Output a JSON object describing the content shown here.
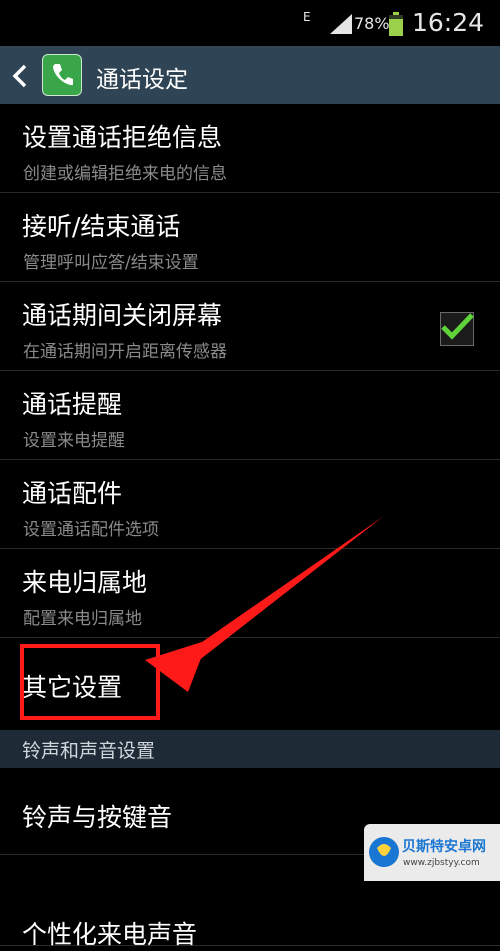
{
  "status": {
    "network": "E",
    "battery_pct": "78%",
    "time": "16:24"
  },
  "header": {
    "title": "通话设定"
  },
  "items": [
    {
      "title": "设置通话拒绝信息",
      "subtitle": "创建或编辑拒绝来电的信息"
    },
    {
      "title": "接听/结束通话",
      "subtitle": "管理呼叫应答/结束设置"
    },
    {
      "title": "通话期间关闭屏幕",
      "subtitle": "在通话期间开启距离传感器",
      "checked": true
    },
    {
      "title": "通话提醒",
      "subtitle": "设置来电提醒"
    },
    {
      "title": "通话配件",
      "subtitle": "设置通话配件选项"
    },
    {
      "title": "来电归属地",
      "subtitle": "配置来电归属地"
    },
    {
      "title": "其它设置"
    }
  ],
  "section": {
    "title": "铃声和声音设置"
  },
  "sound_items": [
    {
      "title": "铃声与按键音"
    },
    {
      "title": "个性化来电声音"
    }
  ],
  "watermark": {
    "name": "贝斯特安卓网",
    "url": "www.zjbstyy.com"
  },
  "colors": {
    "action_bar": "#2f4556",
    "check_mark": "#5fd33a",
    "annotation": "#ff1a1a"
  }
}
